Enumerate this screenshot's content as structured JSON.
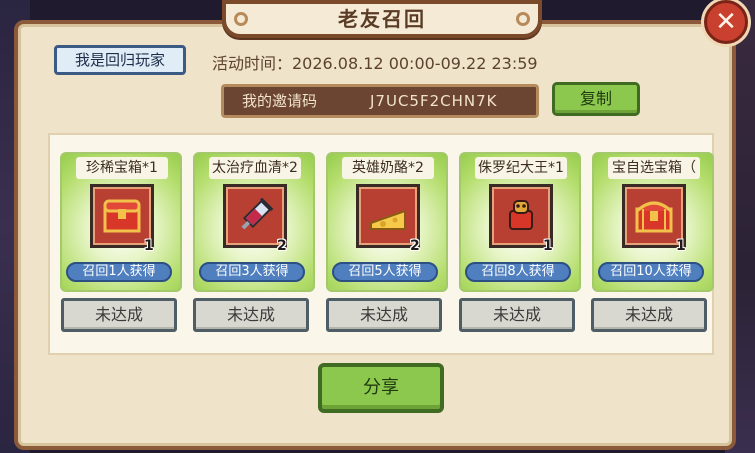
{
  "title": "老友召回",
  "returner_button": "我是回归玩家",
  "event_time": "活动时间：2026.08.12 00:00-09.22 23:59",
  "invite": {
    "label": "我的邀请码",
    "code": "J7UC5F2CHN7K"
  },
  "copy_button": "复制",
  "rewards": [
    {
      "name": "珍稀宝箱*1",
      "icon": "treasure-chest-icon",
      "count": "1",
      "requirement": "召回1人获得",
      "status": "未达成"
    },
    {
      "name": "太治疗血清*2",
      "icon": "syringe-icon",
      "count": "2",
      "requirement": "召回3人获得",
      "status": "未达成"
    },
    {
      "name": "英雄奶酪*2",
      "icon": "cheese-icon",
      "count": "2",
      "requirement": "召回5人获得",
      "status": "未达成"
    },
    {
      "name": "侏罗纪大王*1",
      "icon": "jurassic-king-icon",
      "count": "1",
      "requirement": "召回8人获得",
      "status": "未达成"
    },
    {
      "name": "宝自选宝箱（",
      "icon": "selectable-chest-icon",
      "count": "1",
      "requirement": "召回10人获得",
      "status": "未达成"
    }
  ],
  "share_button": "分享",
  "close_icon": "close-icon"
}
